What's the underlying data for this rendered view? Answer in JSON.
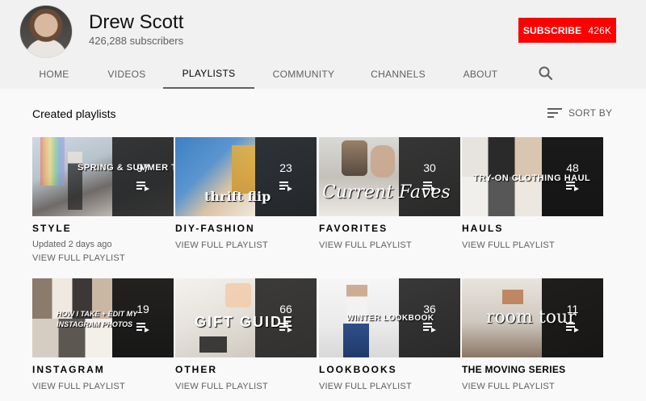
{
  "channel": {
    "name": "Drew Scott",
    "subscribers": "426,288 subscribers",
    "subscribe_label": "SUBSCRIBE",
    "subscribe_count": "426K"
  },
  "tabs": [
    "HOME",
    "VIDEOS",
    "PLAYLISTS",
    "COMMUNITY",
    "CHANNELS",
    "ABOUT"
  ],
  "active_tab": "PLAYLISTS",
  "search_icon": "search-icon",
  "section": {
    "title": "Created playlists",
    "sort_label": "SORT BY",
    "sort_icon": "sort-icon"
  },
  "playlists": [
    {
      "title": "STYLE",
      "count": "97",
      "updated": "Updated 2 days ago",
      "link": "VIEW FULL PLAYLIST",
      "overlay": "SPRING & SUMMER TRENDS"
    },
    {
      "title": "DIY-FASHION",
      "count": "23",
      "link": "VIEW FULL PLAYLIST",
      "overlay": "thrift flip"
    },
    {
      "title": "FAVORITES",
      "count": "30",
      "link": "VIEW FULL PLAYLIST",
      "overlay": "Current Faves"
    },
    {
      "title": "HAULS",
      "count": "48",
      "link": "VIEW FULL PLAYLIST",
      "overlay": "TRY-ON CLOTHING HAUL"
    },
    {
      "title": "INSTAGRAM",
      "count": "19",
      "link": "VIEW FULL PLAYLIST",
      "overlay": "HOW I TAKE + EDIT MY INSTAGRAM PHOTOS"
    },
    {
      "title": "OTHER",
      "count": "66",
      "link": "VIEW FULL PLAYLIST",
      "overlay": "GIFT GUIDE"
    },
    {
      "title": "LOOKBOOKS",
      "count": "36",
      "link": "VIEW FULL PLAYLIST",
      "overlay": "WINTER LOOKBOOK"
    },
    {
      "title": "THE MOVING SERIES",
      "count": "11",
      "link": "VIEW FULL PLAYLIST",
      "overlay": "room tour"
    }
  ],
  "colors": {
    "subscribe": "#ff0000",
    "background": "#f9f9f9",
    "header": "#f1f1f1",
    "secondary_text": "#606060"
  }
}
